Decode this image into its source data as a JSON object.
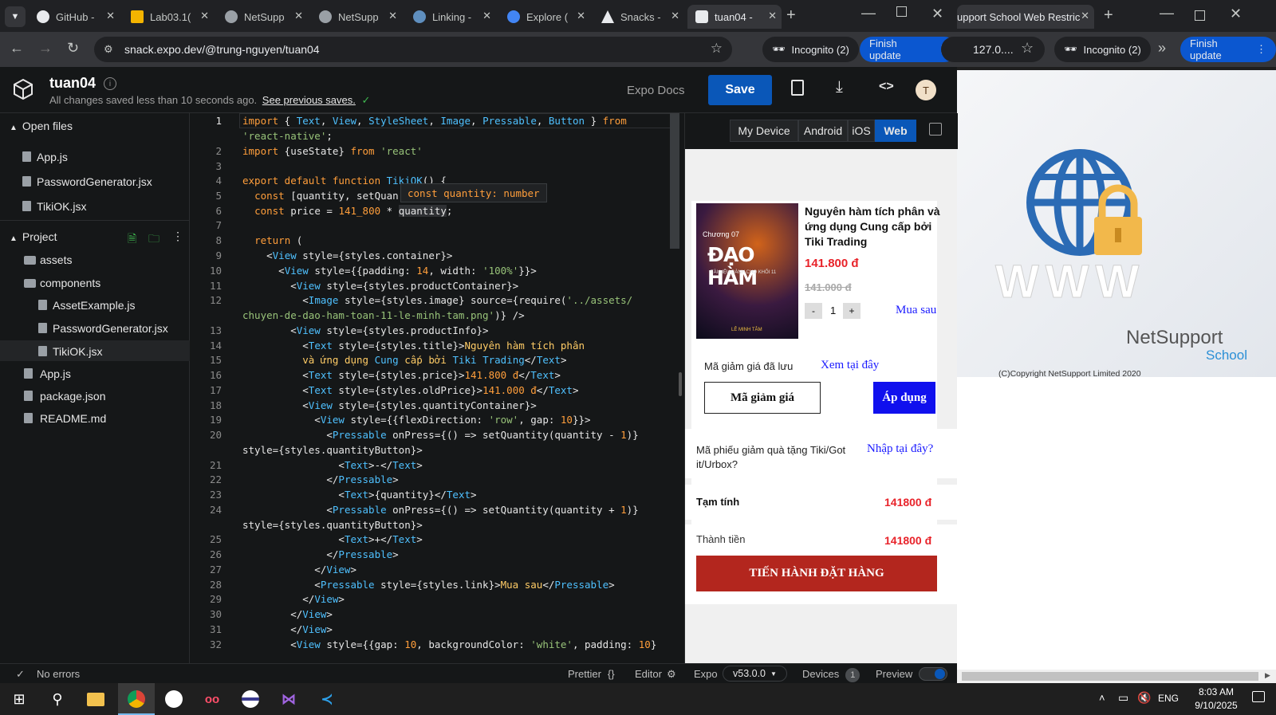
{
  "browser": {
    "tabs": [
      {
        "label": "GitHub -"
      },
      {
        "label": "Lab03.1("
      },
      {
        "label": "NetSupp"
      },
      {
        "label": "NetSupp"
      },
      {
        "label": "Linking -"
      },
      {
        "label": "Explore ("
      },
      {
        "label": "Snacks -"
      },
      {
        "label": "tuan04 -"
      }
    ],
    "url": "snack.expo.dev/@trung-nguyen/tuan04",
    "incognito": "Incognito (2)",
    "finish_update": "Finish update",
    "right_tab": "upport School Web Restric",
    "right_url": "127.0....",
    "right_incognito": "Incognito (2)",
    "right_finish_update": "Finish update"
  },
  "snack": {
    "title": "tuan04",
    "status": "All changes saved less than 10 seconds ago.",
    "previous_saves": "See previous saves.",
    "docs": "Expo Docs",
    "save": "Save",
    "avatar": "T"
  },
  "sidebar": {
    "open_files_label": "Open files",
    "open_files": [
      "App.js",
      "PasswordGenerator.jsx",
      "TikiOK.jsx"
    ],
    "project_label": "Project",
    "project": {
      "assets": "assets",
      "components": "components",
      "component_files": [
        "AssetExample.js",
        "PasswordGenerator.jsx",
        "TikiOK.jsx"
      ],
      "root_files": [
        "App.js",
        "package.json",
        "README.md"
      ]
    }
  },
  "editor": {
    "line_numbers": [
      "1",
      "2",
      "3",
      "4",
      "5",
      "6",
      "7",
      "8",
      "9",
      "10",
      "11",
      "12",
      "13",
      "14",
      "15",
      "16",
      "17",
      "18",
      "19",
      "20",
      "21",
      "22",
      "23",
      "24",
      "25",
      "26",
      "27",
      "28",
      "29",
      "30",
      "31",
      "32"
    ],
    "tooltip": "const quantity: number"
  },
  "preview": {
    "device_tabs": [
      "My Device",
      "Android",
      "iOS",
      "Web"
    ],
    "product_title": "Nguyên hàm tích phân và ứng dụng Cung cấp bởi Tiki Trading",
    "book_top": "Chương 07",
    "book_title": "ĐẠO HÀM",
    "book_sub": "TÀI LIỆU DÀNH CHO KHỐI 11",
    "book_author": "LÊ MINH TÂM",
    "price": "141.800 đ",
    "old_price": "141.000 đ",
    "qty_minus": "-",
    "qty": "1",
    "qty_plus": "+",
    "buy_later": "Mua sau",
    "saved_coupon": "Mã giảm giá đã lưu",
    "see_here": "Xem tại đây",
    "coupon_button": "Mã giảm giá",
    "apply_button": "Áp dụng",
    "gift_text": "Mã phiếu giảm quà tặng Tiki/Got it/Urbox?",
    "enter_here": "Nhập tại đây?",
    "subtotal_label": "Tạm tính",
    "subtotal_value": "141800 đ",
    "total_label": "Thành tiền",
    "total_value": "141800 đ",
    "order_button": "TIẾN HÀNH ĐẶT HÀNG"
  },
  "netsupport": {
    "www": "WWW",
    "brand": "NetSupport",
    "school": "School",
    "copyright": "(C)Copyright NetSupport Limited 2020"
  },
  "statusbar": {
    "errors": "No errors",
    "prettier": "Prettier",
    "editor": "Editor",
    "expo": "Expo",
    "version": "v53.0.0",
    "devices": "Devices",
    "devices_count": "1",
    "preview": "Preview"
  },
  "taskbar": {
    "lang": "ENG",
    "time": "8:03 AM",
    "date": "9/10/2025"
  },
  "colors": {
    "accent": "#0a57b8",
    "price_red": "#e8232a",
    "order_red": "#b3261e",
    "link_blue": "#1a1aff"
  }
}
